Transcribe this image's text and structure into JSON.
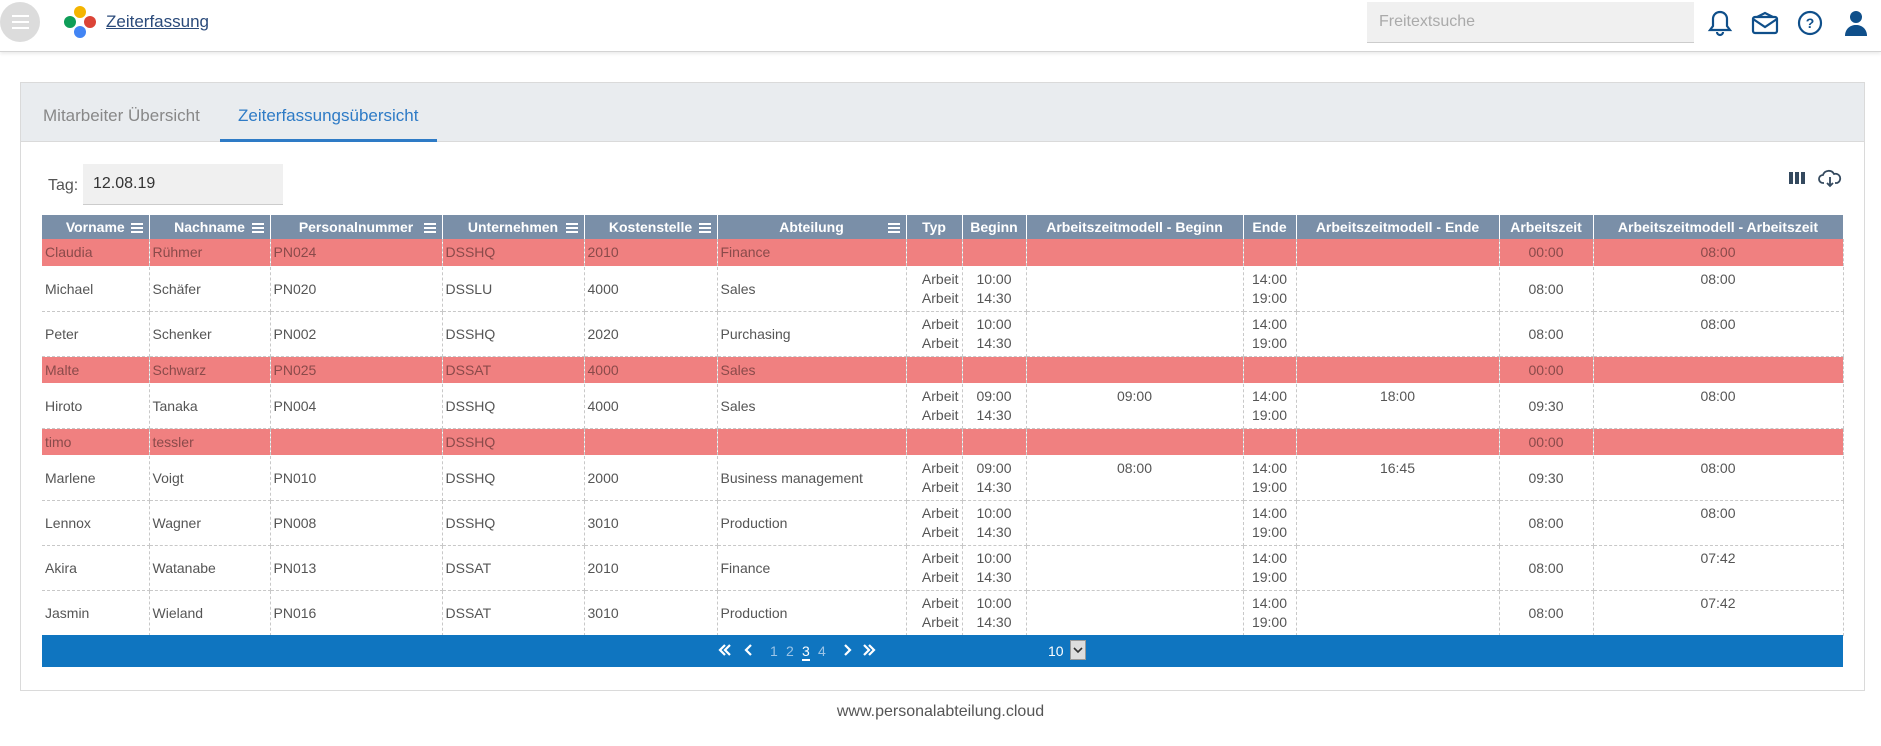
{
  "header": {
    "app_title": "Zeiterfassung",
    "search_placeholder": "Freitextsuche"
  },
  "tabs": [
    {
      "label": "Mitarbeiter Übersicht",
      "active": false
    },
    {
      "label": "Zeiterfassungsübersicht",
      "active": true
    }
  ],
  "filter": {
    "tag_label": "Tag:",
    "tag_value": "12.08.19"
  },
  "columns": [
    "Vorname",
    "Nachname",
    "Personalnummer",
    "Unternehmen",
    "Kostenstelle",
    "Abteilung",
    "Typ",
    "Beginn",
    "Arbeitszeitmodell - Beginn",
    "Ende",
    "Arbeitszeitmodell - Ende",
    "Arbeitszeit",
    "Arbeitszeitmodell - Arbeitszeit"
  ],
  "rows": [
    {
      "vorname": "Claudia",
      "nachname": "Rühmer",
      "personalnummer": "PN024",
      "unternehmen": "DSSHQ",
      "kostenstelle": "2010",
      "abteilung": "Finance",
      "typ1": "",
      "typ2": "",
      "beginn1": "",
      "beginn2": "",
      "az_beginn": "",
      "ende1": "",
      "ende2": "",
      "az_ende": "",
      "arbeitszeit": "00:00",
      "az_arbeitszeit": "08:00"
    },
    {
      "vorname": "Michael",
      "nachname": "Schäfer",
      "personalnummer": "PN020",
      "unternehmen": "DSSLU",
      "kostenstelle": "4000",
      "abteilung": "Sales",
      "typ1": "Arbeit",
      "typ2": "Arbeit",
      "beginn1": "10:00",
      "beginn2": "14:30",
      "az_beginn": "",
      "ende1": "14:00",
      "ende2": "19:00",
      "az_ende": "",
      "arbeitszeit": "08:00",
      "az_arbeitszeit": "08:00"
    },
    {
      "vorname": "Peter",
      "nachname": "Schenker",
      "personalnummer": "PN002",
      "unternehmen": "DSSHQ",
      "kostenstelle": "2020",
      "abteilung": "Purchasing",
      "typ1": "Arbeit",
      "typ2": "Arbeit",
      "beginn1": "10:00",
      "beginn2": "14:30",
      "az_beginn": "",
      "ende1": "14:00",
      "ende2": "19:00",
      "az_ende": "",
      "arbeitszeit": "08:00",
      "az_arbeitszeit": "08:00"
    },
    {
      "vorname": "Malte",
      "nachname": "Schwarz",
      "personalnummer": "PN025",
      "unternehmen": "DSSAT",
      "kostenstelle": "4000",
      "abteilung": "Sales",
      "typ1": "",
      "typ2": "",
      "beginn1": "",
      "beginn2": "",
      "az_beginn": "",
      "ende1": "",
      "ende2": "",
      "az_ende": "",
      "arbeitszeit": "00:00",
      "az_arbeitszeit": ""
    },
    {
      "vorname": "Hiroto",
      "nachname": "Tanaka",
      "personalnummer": "PN004",
      "unternehmen": "DSSHQ",
      "kostenstelle": "4000",
      "abteilung": "Sales",
      "typ1": "Arbeit",
      "typ2": "Arbeit",
      "beginn1": "09:00",
      "beginn2": "14:30",
      "az_beginn": "09:00",
      "ende1": "14:00",
      "ende2": "19:00",
      "az_ende": "18:00",
      "arbeitszeit": "09:30",
      "az_arbeitszeit": "08:00"
    },
    {
      "vorname": "timo",
      "nachname": "tessler",
      "personalnummer": "",
      "unternehmen": "DSSHQ",
      "kostenstelle": "",
      "abteilung": "",
      "typ1": "",
      "typ2": "",
      "beginn1": "",
      "beginn2": "",
      "az_beginn": "",
      "ende1": "",
      "ende2": "",
      "az_ende": "",
      "arbeitszeit": "00:00",
      "az_arbeitszeit": ""
    },
    {
      "vorname": "Marlene",
      "nachname": "Voigt",
      "personalnummer": "PN010",
      "unternehmen": "DSSHQ",
      "kostenstelle": "2000",
      "abteilung": "Business management",
      "typ1": "Arbeit",
      "typ2": "Arbeit",
      "beginn1": "09:00",
      "beginn2": "14:30",
      "az_beginn": "08:00",
      "ende1": "14:00",
      "ende2": "19:00",
      "az_ende": "16:45",
      "arbeitszeit": "09:30",
      "az_arbeitszeit": "08:00"
    },
    {
      "vorname": "Lennox",
      "nachname": "Wagner",
      "personalnummer": "PN008",
      "unternehmen": "DSSHQ",
      "kostenstelle": "3010",
      "abteilung": "Production",
      "typ1": "Arbeit",
      "typ2": "Arbeit",
      "beginn1": "10:00",
      "beginn2": "14:30",
      "az_beginn": "",
      "ende1": "14:00",
      "ende2": "19:00",
      "az_ende": "",
      "arbeitszeit": "08:00",
      "az_arbeitszeit": "08:00"
    },
    {
      "vorname": "Akira",
      "nachname": "Watanabe",
      "personalnummer": "PN013",
      "unternehmen": "DSSAT",
      "kostenstelle": "2010",
      "abteilung": "Finance",
      "typ1": "Arbeit",
      "typ2": "Arbeit",
      "beginn1": "10:00",
      "beginn2": "14:30",
      "az_beginn": "",
      "ende1": "14:00",
      "ende2": "19:00",
      "az_ende": "",
      "arbeitszeit": "08:00",
      "az_arbeitszeit": "07:42"
    },
    {
      "vorname": "Jasmin",
      "nachname": "Wieland",
      "personalnummer": "PN016",
      "unternehmen": "DSSAT",
      "kostenstelle": "3010",
      "abteilung": "Production",
      "typ1": "Arbeit",
      "typ2": "Arbeit",
      "beginn1": "10:00",
      "beginn2": "14:30",
      "az_beginn": "",
      "ende1": "14:00",
      "ende2": "19:00",
      "az_ende": "",
      "arbeitszeit": "08:00",
      "az_arbeitszeit": "07:42"
    }
  ],
  "pagination": {
    "pages": [
      "1",
      "2",
      "3",
      "4"
    ],
    "current": "3",
    "page_size": "10"
  },
  "footer": {
    "text": "www.personalabteilung.cloud"
  },
  "colors": {
    "accent": "#0f75c0",
    "header_row": "#7a8fa8",
    "missing_row": "#f08080",
    "warning_text": "#f06060"
  }
}
